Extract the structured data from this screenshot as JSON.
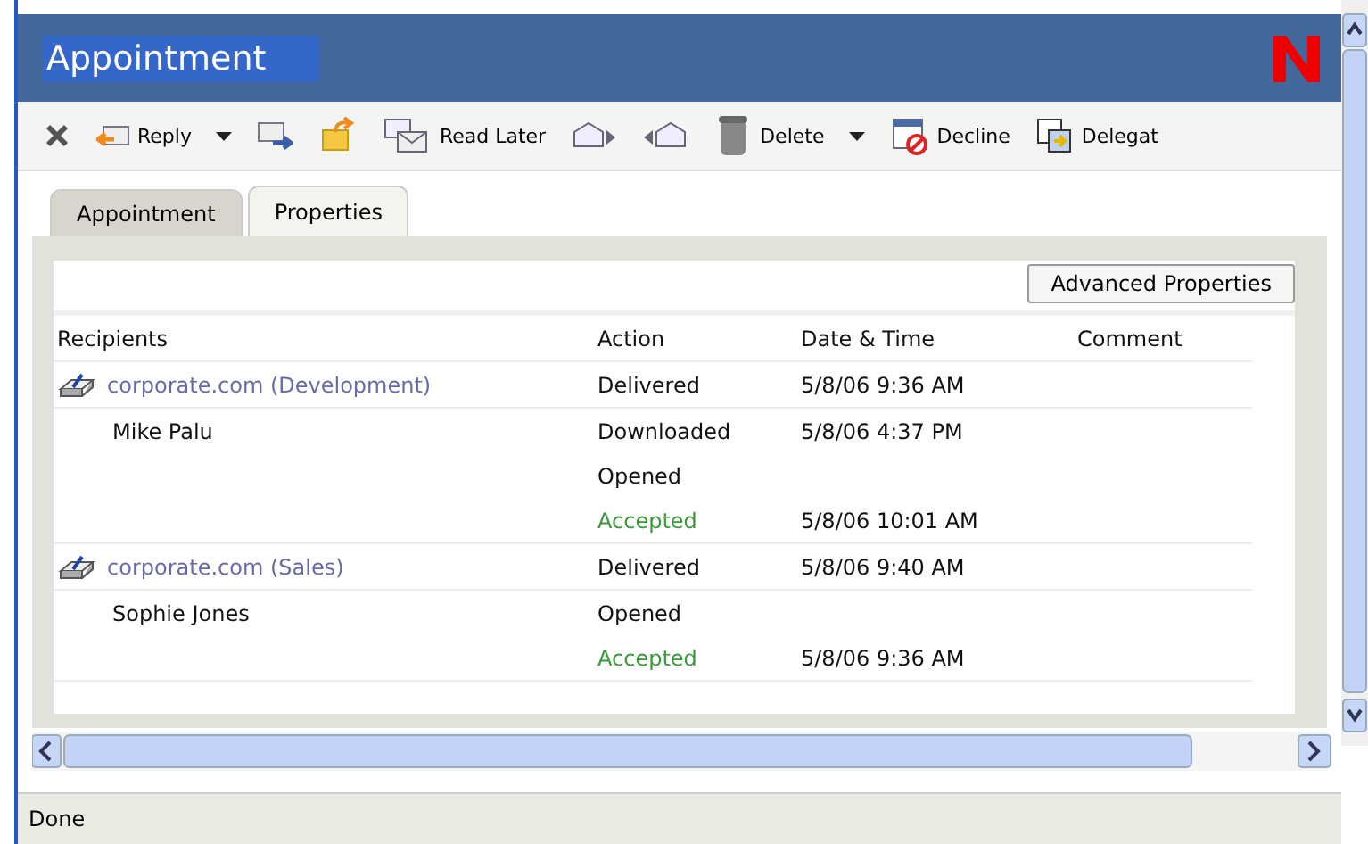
{
  "window": {
    "title": "Appointment"
  },
  "toolbar": [
    {
      "kind": "icon"
    },
    {
      "kind": "split",
      "label": "Reply"
    },
    {
      "kind": "icon"
    },
    {
      "kind": "icon"
    },
    {
      "kind": "button",
      "label": "Read Later"
    },
    {
      "kind": "icon"
    },
    {
      "kind": "icon"
    },
    {
      "kind": "split",
      "label": "Delete"
    },
    {
      "kind": "button",
      "label": "Decline"
    },
    {
      "kind": "button",
      "label": "Delegat"
    }
  ],
  "tabs": [
    {
      "label": "Appointment",
      "selected": false
    },
    {
      "label": "Properties",
      "selected": true
    }
  ],
  "advanced_button": "Advanced Properties",
  "table": {
    "columns": [
      "Recipients",
      "Action",
      "Date & Time",
      "Comment"
    ],
    "rows": [
      {
        "kind": "group",
        "recipient": "corporate.com (Development)",
        "lines": [
          {
            "action": "Delivered",
            "date": "5/8/06 9:36 AM",
            "accepted": false
          }
        ]
      },
      {
        "kind": "person",
        "recipient": "Mike Palu",
        "lines": [
          {
            "action": "Downloaded",
            "date": "5/8/06 4:37 PM",
            "accepted": false
          },
          {
            "action": "Opened",
            "accepted": false
          },
          {
            "action": "Accepted",
            "date": "5/8/06 10:01 AM",
            "accepted": true
          }
        ]
      },
      {
        "kind": "group",
        "recipient": "corporate.com (Sales)",
        "lines": [
          {
            "action": "Delivered",
            "date": "5/8/06 9:40 AM",
            "accepted": false
          }
        ]
      },
      {
        "kind": "person",
        "recipient": "Sophie Jones",
        "lines": [
          {
            "action": "Opened",
            "accepted": false
          },
          {
            "action": "Accepted",
            "date": "5/8/06 9:36 AM",
            "accepted": true
          }
        ]
      }
    ]
  },
  "status_bar": "Done"
}
